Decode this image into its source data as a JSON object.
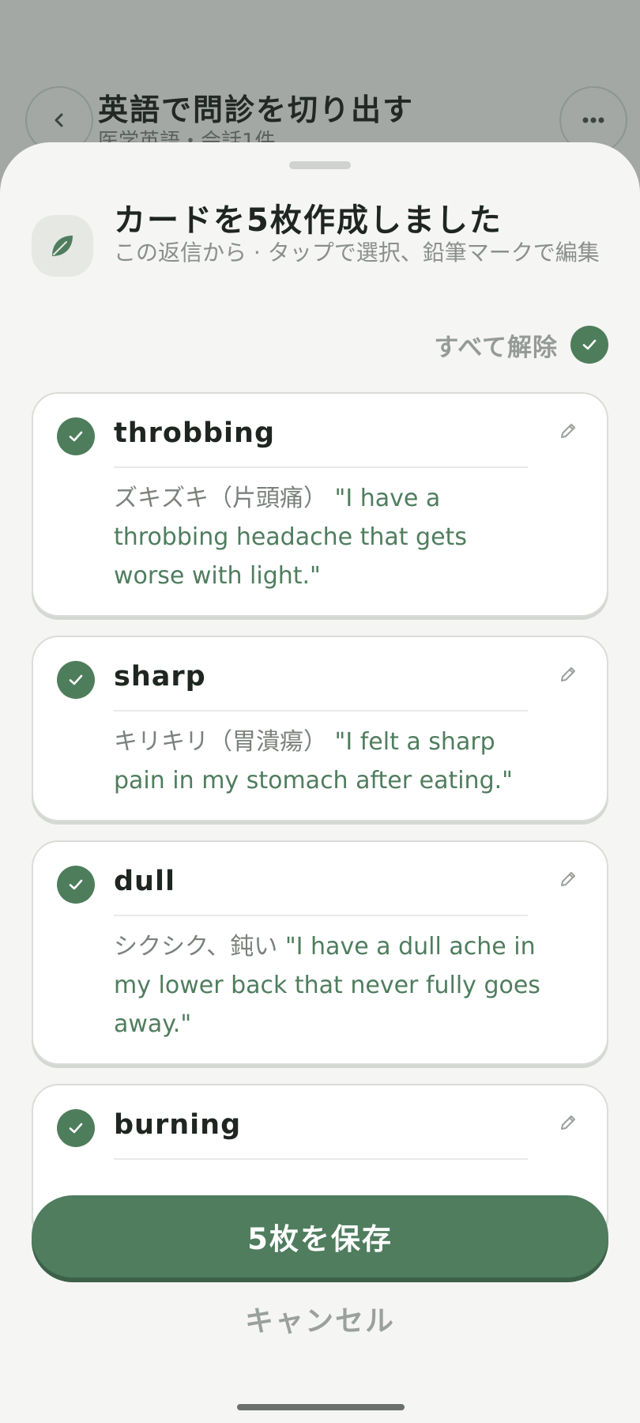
{
  "background": {
    "title": "英語で問診を切り出す",
    "subtitle": "医学英語・会話1件"
  },
  "sheet": {
    "title": "カードを5枚作成しました",
    "subtitle": "この返信から · タップで選択、鉛筆マークで編集",
    "deselect_all_label": "すべて解除"
  },
  "cards": [
    {
      "term": "throbbing",
      "jp": "ズキズキ（片頭痛）",
      "example": "\"I have a throbbing headache that gets worse with light.\"",
      "selected": true
    },
    {
      "term": "sharp",
      "jp": "キリキリ（胃潰瘍）",
      "example": "\"I felt a sharp pain in my stomach after eating.\"",
      "selected": true
    },
    {
      "term": "dull",
      "jp": "シクシク、鈍い",
      "example": "\"I have a dull ache in my lower back that never fully goes away.\"",
      "selected": true
    },
    {
      "term": "burning",
      "jp": "",
      "example": "",
      "selected": true
    }
  ],
  "actions": {
    "save_label": "5枚を保存",
    "cancel_label": "キャンセル"
  },
  "colors": {
    "accent": "#4f7d5e",
    "sheet_bg": "#f5f5f3",
    "overlay": "#a3a8a4"
  },
  "icons": {
    "back": "chevron-left-icon",
    "more": "more-horizontal-icon",
    "leaf": "leaf-icon",
    "check": "check-icon",
    "edit": "pencil-icon"
  }
}
